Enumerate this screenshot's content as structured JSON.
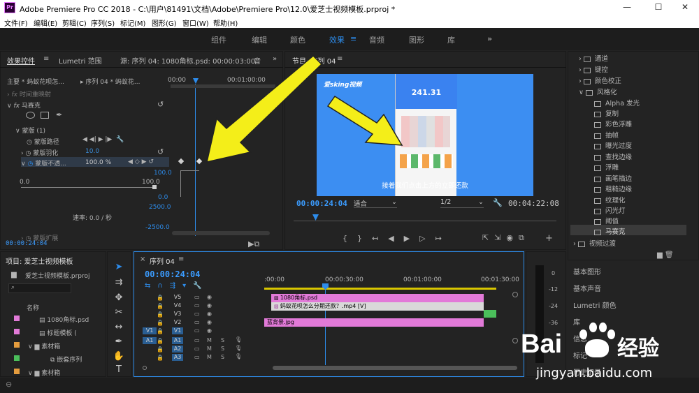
{
  "title_bar": {
    "app_title": "Adobe Premiere Pro CC 2018 - C:\\用户\\81491\\文档\\Adobe\\Premiere Pro\\12.0\\爱芝士视频模板.prproj *",
    "app_icon": "Pr",
    "minimize": "—",
    "maximize": "☐",
    "close": "✕"
  },
  "menu": [
    "文件(F)",
    "编辑(E)",
    "剪辑(C)",
    "序列(S)",
    "标记(M)",
    "图形(G)",
    "窗口(W)",
    "帮助(H)"
  ],
  "workspaces": [
    "组件",
    "编辑",
    "颜色",
    "效果",
    "音频",
    "图形",
    "库"
  ],
  "workspace_menu": "≡",
  "workspace_more": "»",
  "effect_controls": {
    "tab_effect_controls": "效果控件",
    "tab_menu": "≡",
    "tab_lumetri": "Lumetri 范围",
    "tab_source": "源: 序列 04: 1080角标.psd: 00:00:03:00",
    "tab_audio": "音",
    "master": "主要 * 蚂蚁花呗怎...",
    "sequence": "序列 04 * 蚂蚁花...",
    "ruler": [
      "00:00",
      "00:01:00:00"
    ],
    "rows": {
      "time_remap": "时间重映射",
      "mosaic": "马赛克",
      "mask": "蒙版 (1)",
      "mask_path": "蒙版路径",
      "mask_feather": "蒙版羽化",
      "mask_feather_val": "10.0",
      "mask_opacity": "蒙版不透...",
      "mask_opacity_val": "100.0 %",
      "slider_min": "0.0",
      "slider_max": "100.0",
      "graph_top": "100.0",
      "graph_mid": "0.0",
      "graph_zero": "0.0",
      "rate_label": "速率: 0.0 / 秒",
      "rate_top": "2500.0",
      "rate_bottom": "-2500.0",
      "mask_expand": "蒙版扩展"
    },
    "fx_prefix": "fx",
    "timecode": "00:00:24:04"
  },
  "program": {
    "title": "节目: 序列 04",
    "menu": "≡",
    "timecode": "00:00:24:04",
    "fit": "适合",
    "resolution": "1/2",
    "duration": "00:04:22:08",
    "video_logo": "爱sking视频",
    "video_value": "241.31",
    "subtitle": "接着我们点击上方的立即还款"
  },
  "project": {
    "title": "项目: 爱芝士视频模板",
    "file": "爱芝士视频模板.prproj",
    "col_name": "名称",
    "items": [
      {
        "name": "1080角标.psd",
        "color": "#e27ad8"
      },
      {
        "name": "标题模板 (",
        "color": "#e27ad8"
      },
      {
        "name": "素材箱",
        "color": "#e49c3e"
      },
      {
        "name": "嵌套序列",
        "color": "#4bbf5b"
      },
      {
        "name": "素材箱",
        "color": "#e49c3e"
      }
    ]
  },
  "timeline": {
    "title": "序列 04",
    "menu": "≡",
    "timecode": "00:00:24:04",
    "ruler": [
      ":00:00",
      "00:00:30:00",
      "00:01:00:00",
      "00:01:30:00"
    ],
    "tracks": [
      "V5",
      "V4",
      "V3",
      "V2",
      "V1",
      "A1",
      "A2",
      "A3"
    ],
    "src": [
      "V1",
      "A1"
    ],
    "m": "M",
    "s": "S",
    "clips": [
      {
        "name": "1080角标.psd"
      },
      {
        "name": "蚂蚁花呗怎么分期还款？.mp4 [V]"
      },
      {
        "name": "蓝背景.jpg"
      }
    ]
  },
  "effects_panel": {
    "items": [
      "通道",
      "键控",
      "颜色校正",
      "风格化"
    ],
    "stylize": [
      "Alpha 发光",
      "复制",
      "彩色浮雕",
      "抽帧",
      "曝光过度",
      "查找边缘",
      "浮雕",
      "画笔描边",
      "粗糙边缘",
      "纹理化",
      "闪光灯",
      "阈值",
      "马赛克"
    ],
    "video_transitions": "视频过渡",
    "basic_graphics": "基本图形",
    "basic_sound": "基本声音",
    "lumetri_color": "Lumetri 颜色",
    "library": "库",
    "info": "信息",
    "markers": "标记",
    "history": "历史记录"
  },
  "audio_meter": {
    "labels": [
      "0",
      "-12",
      "-24",
      "-36"
    ]
  },
  "watermark": {
    "logo_text": "Bai",
    "logo_cn": "经验",
    "url": "jingyan.baidu.com"
  },
  "colors": {
    "accent": "#2d8ceb",
    "arrow": "#f4ee19",
    "pink_clip": "#e27ad8",
    "green_clip": "#4bbf5b"
  }
}
